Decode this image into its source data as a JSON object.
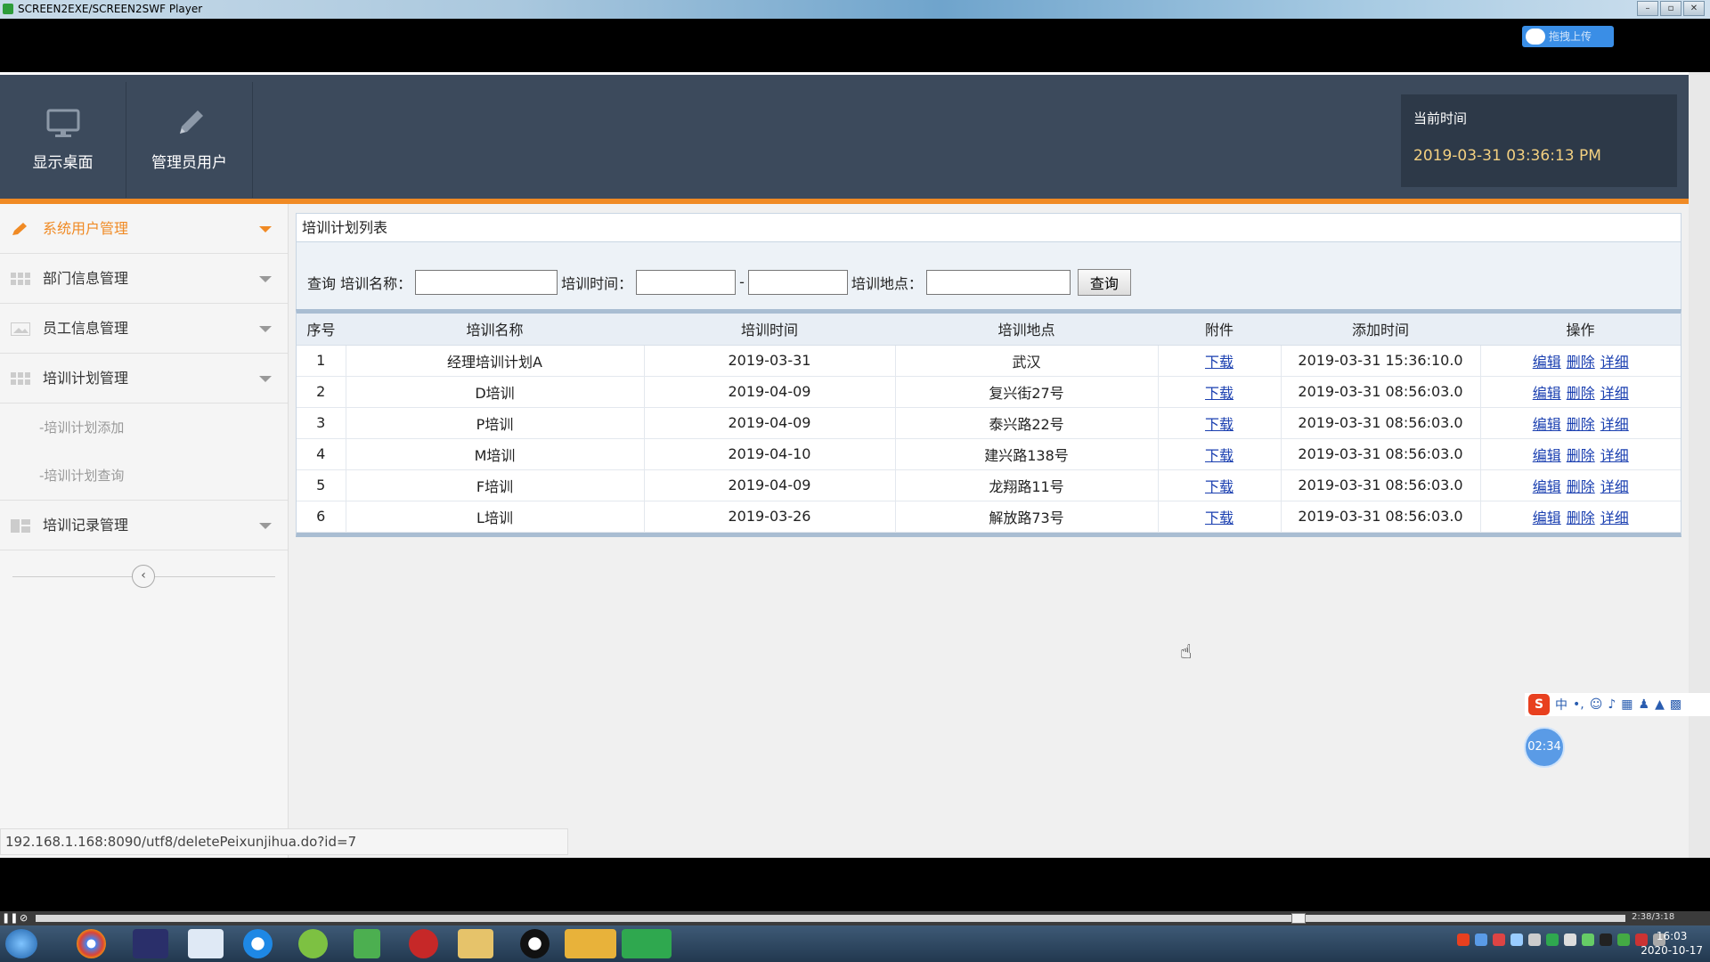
{
  "window": {
    "title": "SCREEN2EXE/SCREEN2SWF Player"
  },
  "upload_button": {
    "label": "拖拽上传"
  },
  "header": {
    "nav": [
      {
        "label": "显示桌面",
        "icon": "monitor-icon"
      },
      {
        "label": "管理员用户",
        "icon": "pencil-icon"
      }
    ],
    "time_label": "当前时间",
    "time_value": "2019-03-31 03:36:13 PM"
  },
  "sidebar": {
    "items": [
      {
        "label": "系统用户管理",
        "icon": "pencil-icon",
        "active": true
      },
      {
        "label": "部门信息管理",
        "icon": "grid-icon"
      },
      {
        "label": "员工信息管理",
        "icon": "image-icon"
      },
      {
        "label": "培训计划管理",
        "icon": "grid-icon"
      },
      {
        "label": "培训记录管理",
        "icon": "tiles-icon"
      }
    ],
    "sub_items": [
      "-培训计划添加",
      "-培训计划查询"
    ],
    "collapse_symbol": "‹"
  },
  "panel": {
    "title": "培训计划列表"
  },
  "search": {
    "query_label": "查询",
    "name_label": "培训名称：",
    "time_label": "培训时间：",
    "range_sep": "-",
    "place_label": "培训地点：",
    "button_label": "查询"
  },
  "table": {
    "headers": [
      "序号",
      "培训名称",
      "培训时间",
      "培训地点",
      "附件",
      "添加时间",
      "操作"
    ],
    "rows": [
      {
        "no": "1",
        "name": "经理培训计划A",
        "date": "2019-03-31",
        "place": "武汉",
        "attach": "下载",
        "added": "2019-03-31 15:36:10.0"
      },
      {
        "no": "2",
        "name": "D培训",
        "date": "2019-04-09",
        "place": "复兴街27号",
        "attach": "下载",
        "added": "2019-03-31 08:56:03.0"
      },
      {
        "no": "3",
        "name": "P培训",
        "date": "2019-04-09",
        "place": "泰兴路22号",
        "attach": "下载",
        "added": "2019-03-31 08:56:03.0"
      },
      {
        "no": "4",
        "name": "M培训",
        "date": "2019-04-10",
        "place": "建兴路138号",
        "attach": "下载",
        "added": "2019-03-31 08:56:03.0"
      },
      {
        "no": "5",
        "name": "F培训",
        "date": "2019-04-09",
        "place": "龙翔路11号",
        "attach": "下载",
        "added": "2019-03-31 08:56:03.0"
      },
      {
        "no": "6",
        "name": "L培训",
        "date": "2019-03-26",
        "place": "解放路73号",
        "attach": "下载",
        "added": "2019-03-31 08:56:03.0"
      }
    ],
    "ops": [
      "编辑",
      "删除",
      "详细"
    ]
  },
  "status_url": "192.168.1.168:8090/utf8/deletePeixunjihua.do?id=7",
  "timer_badge": "02:34",
  "ime": {
    "logo": "S",
    "lang": "中"
  },
  "player": {
    "time": "2:38/3:18"
  },
  "clock": {
    "time": "16:03",
    "date": "2020-10-17"
  },
  "colors": {
    "accent": "#f08a24",
    "header": "#3c4a5c",
    "link": "#1a3fb0"
  }
}
